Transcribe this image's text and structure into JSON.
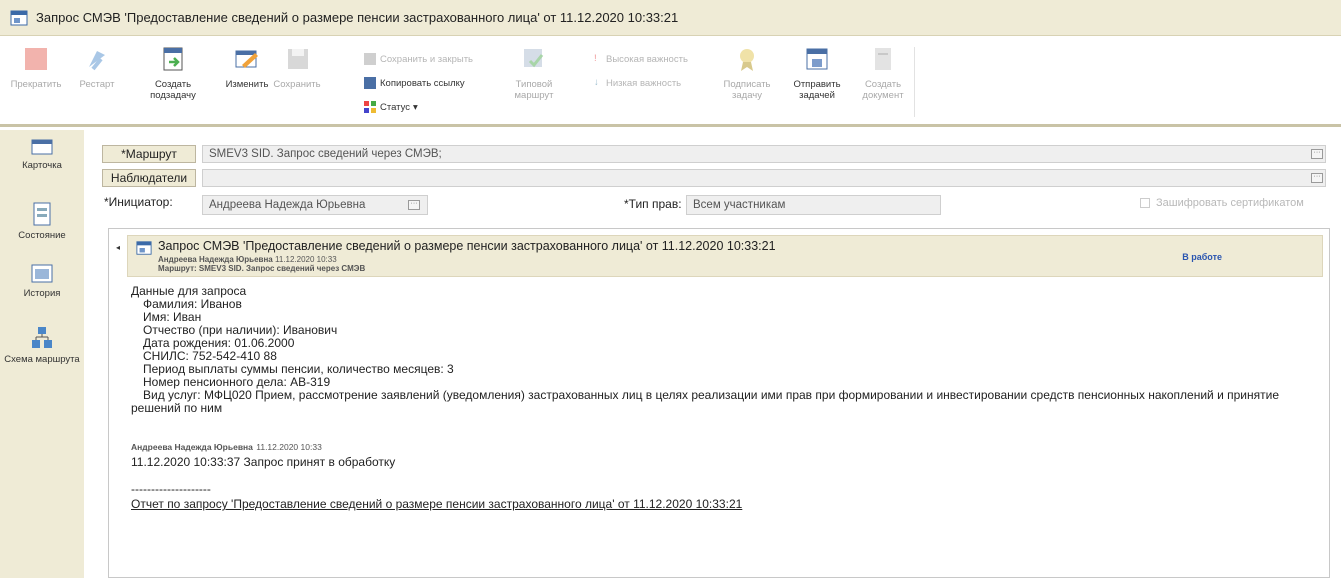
{
  "window": {
    "title": "Запрос СМЭВ 'Предоставление сведений о размере пенсии застрахованного лица' от 11.12.2020 10:33:21"
  },
  "toolbar": {
    "stop": "Прекратить",
    "restart": "Рестарт",
    "create_subtask": "Создать подзадачу",
    "edit": "Изменить",
    "save": "Сохранить",
    "save_close": "Сохранить и закрыть",
    "copy_link": "Копировать ссылку",
    "status": "Статус",
    "typical_route": "Типовой маршрут",
    "high_importance": "Высокая важность",
    "low_importance": "Низкая важность",
    "sign_task": "Подписать задачу",
    "send_task": "Отправить задачей",
    "create_document": "Создать документ"
  },
  "sidebar": {
    "card": "Карточка",
    "state": "Состояние",
    "history": "История",
    "route_scheme": "Схема маршрута"
  },
  "form": {
    "route_label": "*Маршрут",
    "route_value": "SMEV3 SID. Запрос сведений через СМЭВ;",
    "observers_label": "Наблюдатели",
    "observers_value": "",
    "initiator_label": "*Инициатор:",
    "initiator_value": "Андреева Надежда Юрьевна",
    "rights_label": "*Тип прав:",
    "rights_value": "Всем участникам",
    "encrypt_label": "Зашифровать сертификатом"
  },
  "task": {
    "title": "Запрос СМЭВ 'Предоставление сведений о размере пенсии застрахованного лица' от 11.12.2020 10:33:21",
    "author": "Андреева Надежда Юрьевна",
    "date": "11.12.2020 10:33",
    "route_line": "Маршрут: SMEV3 SID. Запрос сведений через СМЭВ",
    "status": "В работе",
    "request_header": "Данные для запроса",
    "lines": [
      "Фамилия: Иванов",
      "Имя: Иван",
      "Отчество (при наличии): Иванович",
      "Дата рождения: 01.06.2000",
      "СНИЛС: 752-542-410 88",
      "Период выплаты суммы пенсии, количество месяцев: 3",
      "Номер пенсионного дела: АВ-319"
    ],
    "service_line1": "Вид услуг: МФЦ020 Прием, рассмотрение заявлений (уведомления) застрахованных лиц в целях реализации ими прав при формировании и инвестировании средств пенсионных накоплений и принятие",
    "service_line2": "решений по ним",
    "comment_author": "Андреева Надежда Юрьевна",
    "comment_date": "11.12.2020 10:33",
    "comment_text": "11.12.2020 10:33:37 Запрос принят в обработку",
    "separator": "--------------------",
    "report_link": "Отчет по запросу 'Предоставление сведений о размере пенсии застрахованного лица' от 11.12.2020 10:33:21"
  }
}
